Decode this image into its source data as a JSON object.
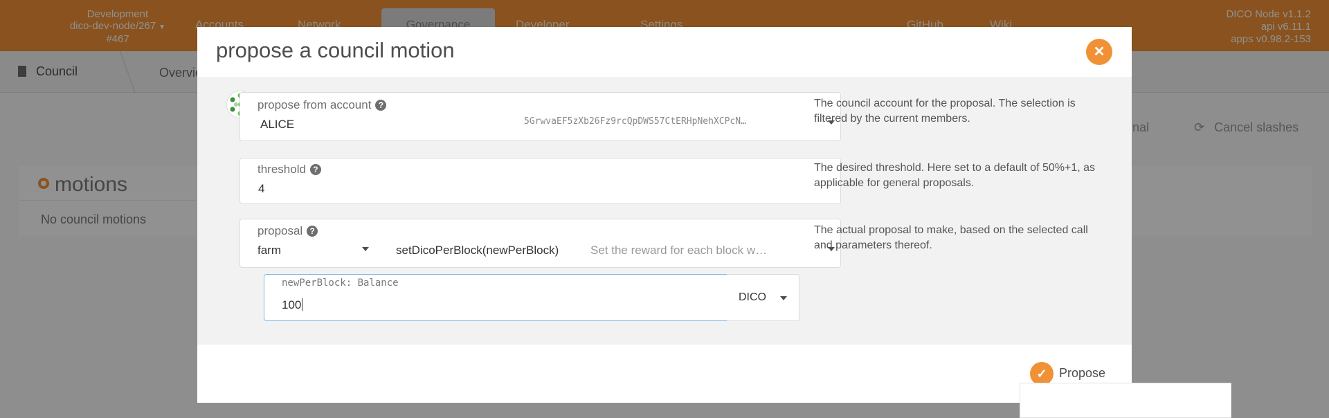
{
  "topbar": {
    "chain_lines": [
      "Development",
      "dico-dev-node/267",
      "#467"
    ],
    "menu": [
      "Accounts",
      "Network",
      "Governance",
      "Developer",
      "Settings",
      "GitHub",
      "Wiki"
    ],
    "version_lines": [
      "DICO Node v1.1.2",
      "api v6.11.1",
      "apps v0.98.2-153"
    ]
  },
  "subnav": {
    "title": "Council",
    "tab": "Overview"
  },
  "actions": {
    "external": "ternal",
    "cancel": "Cancel slashes"
  },
  "motions": {
    "title": "motions",
    "empty": "No council motions"
  },
  "modal": {
    "title": "propose a council motion",
    "close_icon": "close-icon",
    "account": {
      "label": "propose from account",
      "name": "ALICE",
      "address": "5GrwvaEF5zXb26Fz9rcQpDWS57CtERHpNehXCPcN…",
      "hint": "The council account for the proposal. The selection is filtered by the current members."
    },
    "threshold": {
      "label": "threshold",
      "value": "4",
      "hint": "The desired threshold. Here set to a default of 50%+1, as applicable for general proposals."
    },
    "proposal": {
      "label": "proposal",
      "section": "farm",
      "method": "setDicoPerBlock(newPerBlock)",
      "method_desc": "Set the reward for each block w…",
      "hint": "The actual proposal to make, based on the selected call and parameters thereof."
    },
    "param": {
      "label": "newPerBlock: Balance",
      "value": "100",
      "unit": "DICO"
    },
    "propose_label": "Propose"
  },
  "colors": {
    "accent": "#f19135",
    "overlay": "rgba(0,0,0,0.43)"
  }
}
